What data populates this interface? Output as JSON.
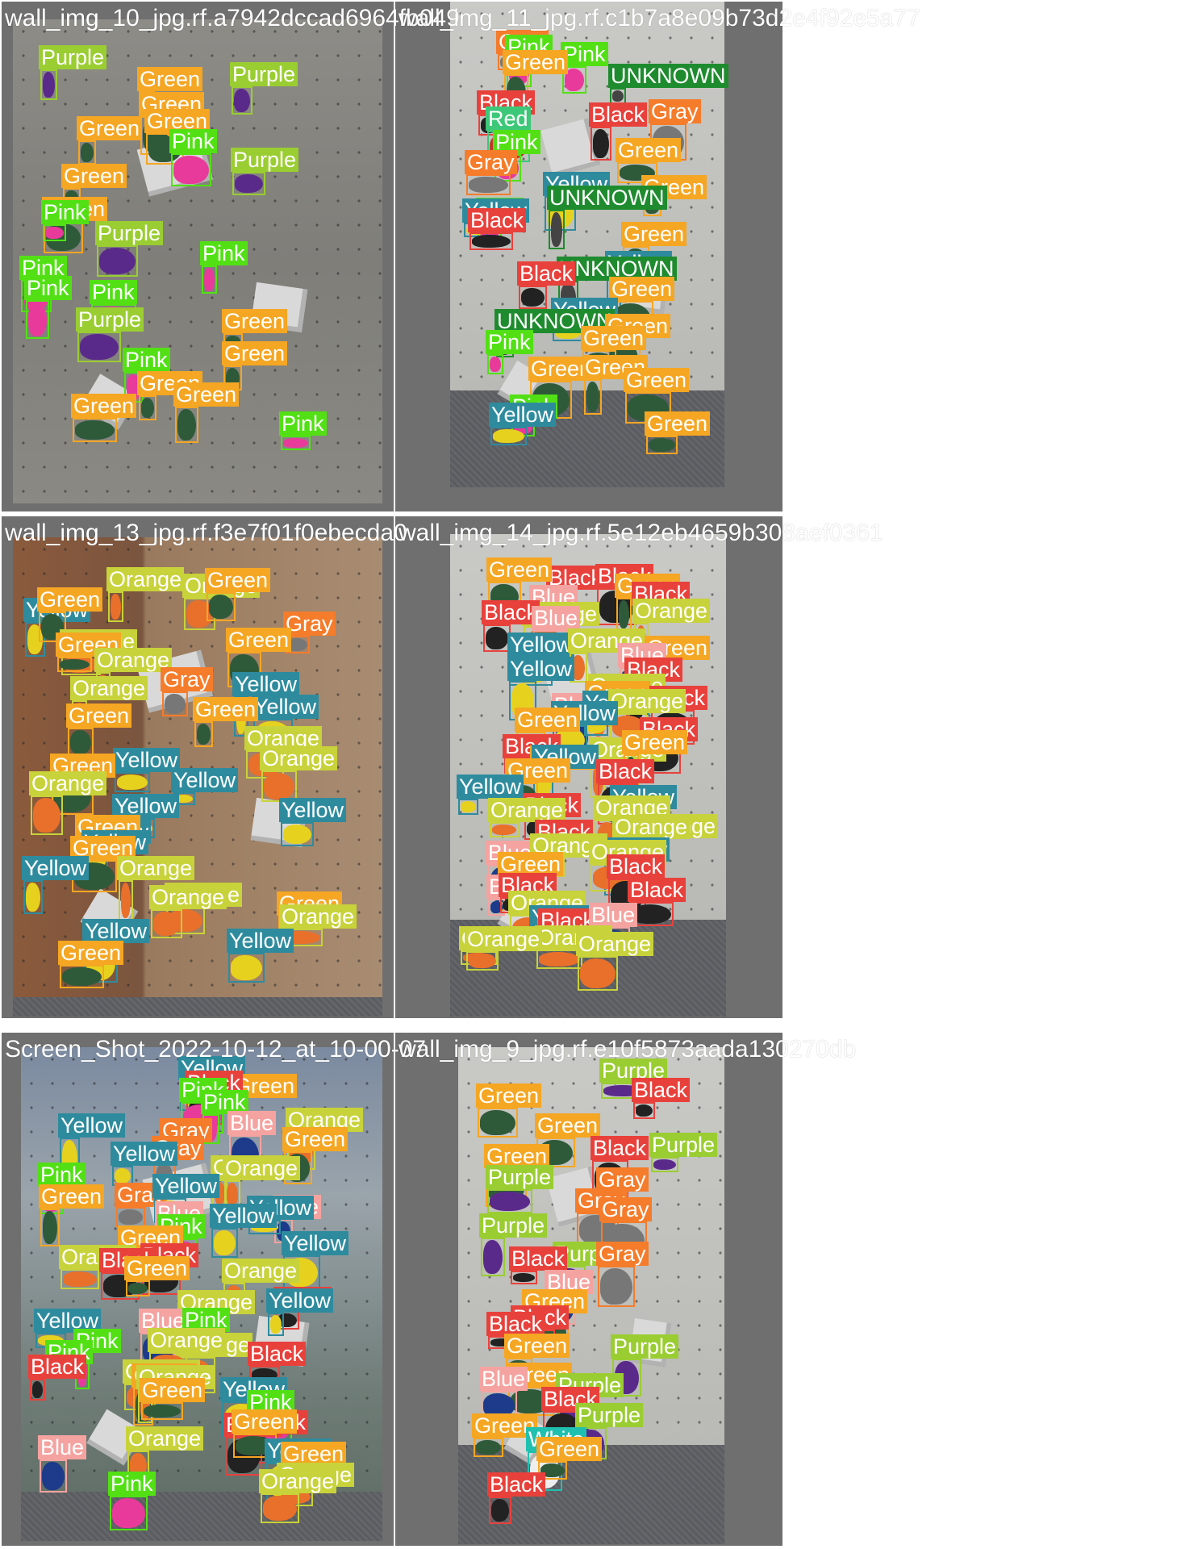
{
  "class_colors": {
    "Green": "#f5a623",
    "Pink": "#52e015",
    "Purple": "#9acd32",
    "Black": "#e8413c",
    "Gray": "#f57c2b",
    "Yellow": "#2e8b9e",
    "Orange": "#c8d23a",
    "Blue": "#f4a3a0",
    "Red": "#3cc878",
    "White": "#20c0b0",
    "UNKNOWN": "#1e8c2e"
  },
  "cells": [
    {
      "title": "wall_img_10_jpg.rf.a7942dccad6964fb049",
      "photo_theme": "concrete",
      "detections": [
        {
          "label": "Purple"
        },
        {
          "label": "Green"
        },
        {
          "label": "Purple"
        },
        {
          "label": "Green"
        },
        {
          "label": "Green"
        },
        {
          "label": "Green"
        },
        {
          "label": "Pink"
        },
        {
          "label": "Purple"
        },
        {
          "label": "Green"
        },
        {
          "label": "Green"
        },
        {
          "label": "Pink"
        },
        {
          "label": "Purple"
        },
        {
          "label": "Pink"
        },
        {
          "label": "Pink"
        },
        {
          "label": "Pink"
        },
        {
          "label": "Pink"
        },
        {
          "label": "Purple"
        },
        {
          "label": "Green"
        },
        {
          "label": "Green"
        },
        {
          "label": "Pink"
        },
        {
          "label": "Green"
        },
        {
          "label": "Green"
        },
        {
          "label": "Green"
        },
        {
          "label": "Pink"
        }
      ]
    },
    {
      "title": "wall_img_11_jpg.rf.c1b7a8e09b73d2e4f92e5a77",
      "photo_theme": "light",
      "detections": [
        {
          "label": "Gray"
        },
        {
          "label": "Pink"
        },
        {
          "label": "Pink"
        },
        {
          "label": "Green"
        },
        {
          "label": "UNKNOWN"
        },
        {
          "label": "Black"
        },
        {
          "label": "Black"
        },
        {
          "label": "Gray"
        },
        {
          "label": "Red"
        },
        {
          "label": "Pink"
        },
        {
          "label": "Green"
        },
        {
          "label": "Gray"
        },
        {
          "label": "Yellow"
        },
        {
          "label": "Green"
        },
        {
          "label": "UNKNOWN"
        },
        {
          "label": "Pink"
        },
        {
          "label": "Yellow"
        },
        {
          "label": "Black"
        },
        {
          "label": "Green"
        },
        {
          "label": "Yellow"
        },
        {
          "label": "UNKNOWN"
        },
        {
          "label": "Black"
        },
        {
          "label": "Green"
        },
        {
          "label": "Yellow"
        },
        {
          "label": "UNKNOWN"
        },
        {
          "label": "Green"
        },
        {
          "label": "Green"
        },
        {
          "label": "Pink"
        },
        {
          "label": "Green"
        },
        {
          "label": "Green"
        },
        {
          "label": "Green"
        },
        {
          "label": "Pink"
        },
        {
          "label": "Yellow"
        },
        {
          "label": "Green"
        }
      ]
    },
    {
      "title": "wall_img_13_jpg.rf.f3e7f01f0ebecda0",
      "photo_theme": "brown",
      "detections": [
        {
          "label": "Orange"
        },
        {
          "label": "Orange"
        },
        {
          "label": "Green"
        },
        {
          "label": "Yellow"
        },
        {
          "label": "Green"
        },
        {
          "label": "Gray"
        },
        {
          "label": "Green"
        },
        {
          "label": "Orange"
        },
        {
          "label": "Green"
        },
        {
          "label": "Orange"
        },
        {
          "label": "Gray"
        },
        {
          "label": "Yellow"
        },
        {
          "label": "Orange"
        },
        {
          "label": "Yellow"
        },
        {
          "label": "Green"
        },
        {
          "label": "Green"
        },
        {
          "label": "Orange"
        },
        {
          "label": "Yellow"
        },
        {
          "label": "Orange"
        },
        {
          "label": "Green"
        },
        {
          "label": "Yellow"
        },
        {
          "label": "Orange"
        },
        {
          "label": "Yellow"
        },
        {
          "label": "Yellow"
        },
        {
          "label": "Yellow"
        },
        {
          "label": "Green"
        },
        {
          "label": "Yellow"
        },
        {
          "label": "Green"
        },
        {
          "label": "Orange"
        },
        {
          "label": "Yellow"
        },
        {
          "label": "Orange"
        },
        {
          "label": "Orange"
        },
        {
          "label": "Green"
        },
        {
          "label": "Orange"
        },
        {
          "label": "Yellow"
        },
        {
          "label": "Yellow"
        },
        {
          "label": "Green"
        }
      ]
    },
    {
      "title": "wall_img_14_jpg.rf.5e12eb4659b308aef0361",
      "photo_theme": "light",
      "detections": [
        {
          "label": "Black"
        },
        {
          "label": "Black"
        },
        {
          "label": "Green"
        },
        {
          "label": "Green"
        },
        {
          "label": "Blue"
        },
        {
          "label": "Black"
        },
        {
          "label": "Orange"
        },
        {
          "label": "Orange"
        },
        {
          "label": "Black"
        },
        {
          "label": "Blue"
        },
        {
          "label": "Yellow"
        },
        {
          "label": "Orange"
        },
        {
          "label": "Green"
        },
        {
          "label": "Blue"
        },
        {
          "label": "Black"
        },
        {
          "label": "Yellow"
        },
        {
          "label": "Orange"
        },
        {
          "label": "Green"
        },
        {
          "label": "Black"
        },
        {
          "label": "Blue"
        },
        {
          "label": "Yellow"
        },
        {
          "label": "Orange"
        },
        {
          "label": "Black"
        },
        {
          "label": "Yellow"
        },
        {
          "label": "Green"
        },
        {
          "label": "Orange"
        },
        {
          "label": "Green"
        },
        {
          "label": "Black"
        },
        {
          "label": "Green"
        },
        {
          "label": "Yellow"
        },
        {
          "label": "Green"
        },
        {
          "label": "Black"
        },
        {
          "label": "Yellow"
        },
        {
          "label": "Yellow"
        },
        {
          "label": "Black"
        },
        {
          "label": "Orange"
        },
        {
          "label": "Orange"
        },
        {
          "label": "Orange"
        },
        {
          "label": "Orange"
        },
        {
          "label": "Black"
        },
        {
          "label": "Blue"
        },
        {
          "label": "Yellow"
        },
        {
          "label": "Orange"
        },
        {
          "label": "Orange"
        },
        {
          "label": "Green"
        },
        {
          "label": "Black"
        },
        {
          "label": "Blue"
        },
        {
          "label": "Black"
        },
        {
          "label": "Black"
        },
        {
          "label": "Orange"
        },
        {
          "label": "Yellow"
        },
        {
          "label": "Black"
        },
        {
          "label": "Blue"
        },
        {
          "label": "Orange"
        },
        {
          "label": "Orange"
        },
        {
          "label": "Orange"
        },
        {
          "label": "Orange"
        }
      ]
    },
    {
      "title": "Screen_Shot_2022-10-12_at_10-00-07",
      "photo_theme": "colorful",
      "detections": [
        {
          "label": "Yellow"
        },
        {
          "label": "Green"
        },
        {
          "label": "Black"
        },
        {
          "label": "Pink"
        },
        {
          "label": "Pink"
        },
        {
          "label": "Blue"
        },
        {
          "label": "Orange"
        },
        {
          "label": "Gray"
        },
        {
          "label": "Yellow"
        },
        {
          "label": "Gray"
        },
        {
          "label": "Green"
        },
        {
          "label": "Yellow"
        },
        {
          "label": "Orange"
        },
        {
          "label": "Orange"
        },
        {
          "label": "Pink"
        },
        {
          "label": "Gray"
        },
        {
          "label": "Yellow"
        },
        {
          "label": "Blue"
        },
        {
          "label": "Green"
        },
        {
          "label": "Yellow"
        },
        {
          "label": "Yellow"
        },
        {
          "label": "Blue"
        },
        {
          "label": "Pink"
        },
        {
          "label": "Yellow"
        },
        {
          "label": "Green"
        },
        {
          "label": "Orange"
        },
        {
          "label": "Black"
        },
        {
          "label": "Black"
        },
        {
          "label": "Green"
        },
        {
          "label": "Orange"
        },
        {
          "label": "Black"
        },
        {
          "label": "Yellow"
        },
        {
          "label": "Orange"
        },
        {
          "label": "Yellow"
        },
        {
          "label": "Blue"
        },
        {
          "label": "Pink"
        },
        {
          "label": "Pink"
        },
        {
          "label": "Orange"
        },
        {
          "label": "Orange"
        },
        {
          "label": "Pink"
        },
        {
          "label": "Black"
        },
        {
          "label": "Black"
        },
        {
          "label": "Orange"
        },
        {
          "label": "Green"
        },
        {
          "label": "Orange"
        },
        {
          "label": "Yellow"
        },
        {
          "label": "Green"
        },
        {
          "label": "Pink"
        },
        {
          "label": "Black"
        },
        {
          "label": "Black"
        },
        {
          "label": "Green"
        },
        {
          "label": "Orange"
        },
        {
          "label": "Blue"
        },
        {
          "label": "Yellow"
        },
        {
          "label": "Green"
        },
        {
          "label": "Orange"
        },
        {
          "label": "Orange"
        },
        {
          "label": "Pink"
        }
      ]
    },
    {
      "title": "wall_img_9_jpg.rf.e10f5873aada130270db",
      "photo_theme": "light",
      "detections": [
        {
          "label": "Purple"
        },
        {
          "label": "Black"
        },
        {
          "label": "Green"
        },
        {
          "label": "Green"
        },
        {
          "label": "Purple"
        },
        {
          "label": "Black"
        },
        {
          "label": "Green"
        },
        {
          "label": "Gray"
        },
        {
          "label": "Purple"
        },
        {
          "label": "Gray"
        },
        {
          "label": "Gray"
        },
        {
          "label": "Purple"
        },
        {
          "label": "Purple"
        },
        {
          "label": "Gray"
        },
        {
          "label": "Black"
        },
        {
          "label": "Blue"
        },
        {
          "label": "Green"
        },
        {
          "label": "Black"
        },
        {
          "label": "Black"
        },
        {
          "label": "Green"
        },
        {
          "label": "Purple"
        },
        {
          "label": "Green"
        },
        {
          "label": "Blue"
        },
        {
          "label": "Purple"
        },
        {
          "label": "Black"
        },
        {
          "label": "Purple"
        },
        {
          "label": "Green"
        },
        {
          "label": "White"
        },
        {
          "label": "Green"
        },
        {
          "label": "Black"
        }
      ]
    }
  ]
}
